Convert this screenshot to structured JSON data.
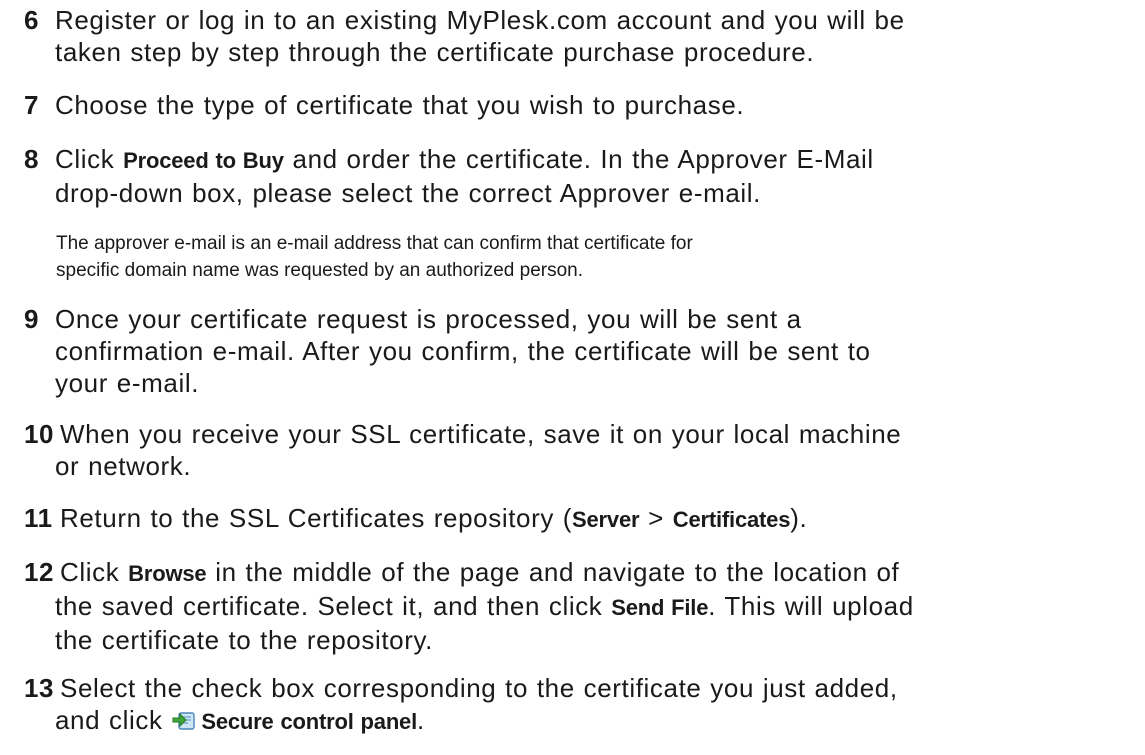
{
  "steps": [
    {
      "number": "6",
      "lines": [
        "Register or log in to an existing MyPlesk.com account and you will be",
        "taken step by step through the certificate purchase procedure."
      ]
    },
    {
      "number": "7",
      "lines": [
        "Choose the type of certificate that you wish to purchase."
      ]
    },
    {
      "number": "8",
      "line1_pre": "Click ",
      "line1_ui": "Proceed to Buy",
      "line1_post": " and order the certificate. In the Approver E-Mail",
      "line2": "drop-down box, please select the correct Approver e-mail.",
      "note": [
        "The approver e-mail is an e-mail address that can confirm that certificate for",
        "specific domain name was requested by an authorized person."
      ]
    },
    {
      "number": "9",
      "lines": [
        "Once your certificate request is processed, you will be sent a",
        "confirmation e-mail. After you confirm, the certificate will be sent to",
        "your e-mail."
      ]
    },
    {
      "number": "10",
      "lines": [
        "When you receive your SSL certificate, save it on your local machine",
        "or network."
      ]
    },
    {
      "number": "11",
      "pre": "Return to the SSL Certificates repository (",
      "ui1": "Server",
      "sep": " > ",
      "ui2": "Certificates",
      "post": ")."
    },
    {
      "number": "12",
      "line1_pre": "Click ",
      "line1_ui": "Browse",
      "line1_post": " in the middle of the page and navigate to the location of",
      "line2_pre": "the saved certificate. Select it, and then click ",
      "line2_ui": "Send File",
      "line2_post": ". This will upload",
      "line3": "the certificate to the repository."
    },
    {
      "number": "13",
      "line1": "Select the check box corresponding to the certificate you just added,",
      "line2_pre": "and click ",
      "line2_icon": "secure-control-panel-icon",
      "line2_ui": "Secure control panel",
      "line2_post": "."
    }
  ]
}
